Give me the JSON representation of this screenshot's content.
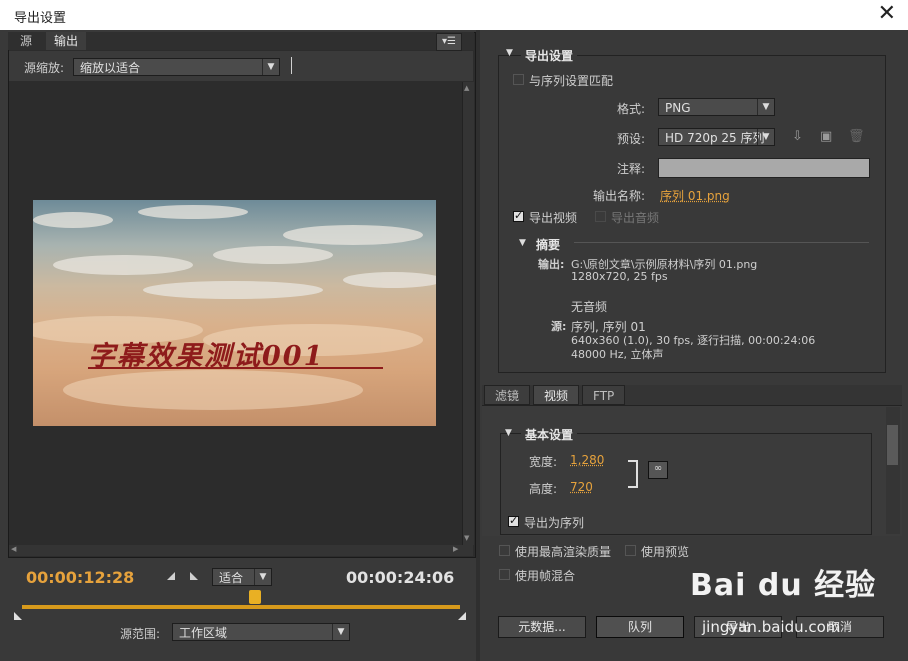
{
  "window": {
    "title": "导出设置",
    "close_glyph": "✕"
  },
  "left": {
    "tabs": [
      {
        "label": "源"
      },
      {
        "label": "输出"
      }
    ],
    "menu_icon": "▾☰",
    "source_scale_label": "源缩放:",
    "source_scale_value": "缩放以适合",
    "video_caption": "字幕效果测试001",
    "current_time": "00:00:12:28",
    "total_time": "00:00:24:06",
    "zoom_value": "适合",
    "source_range_label": "源范围:",
    "source_range_value": "工作区域"
  },
  "export": {
    "section_title": "导出设置",
    "match_sequence": "与序列设置匹配",
    "format_label": "格式:",
    "format_value": "PNG",
    "preset_label": "预设:",
    "preset_value": "HD 720p 25 序列",
    "comment_label": "注释:",
    "output_name_label": "输出名称:",
    "output_name_value": "序列 01.png",
    "export_video": "导出视频",
    "export_audio": "导出音频",
    "summary_title": "摘要",
    "output_label": "输出:",
    "output_line1": "G:\\原创文章\\示例原材料\\序列 01.png",
    "output_line2": "1280x720, 25 fps",
    "output_line3": "无音频",
    "source_label": "源:",
    "source_line1": "序列, 序列 01",
    "source_line2": "640x360 (1.0), 30 fps, 逐行扫描, 00:00:24:06",
    "source_line3": "48000 Hz, 立体声"
  },
  "tabs2": [
    {
      "label": "滤镜"
    },
    {
      "label": "视频"
    },
    {
      "label": "FTP"
    }
  ],
  "basic": {
    "title": "基本设置",
    "width_label": "宽度:",
    "width_value": "1,280",
    "height_label": "高度:",
    "height_value": "720",
    "export_as_sequence": "导出为序列"
  },
  "options": {
    "max_render": "使用最高渲染质量",
    "use_preview": "使用预览",
    "frame_blend": "使用帧混合"
  },
  "buttons": {
    "metadata": "元数据...",
    "queue": "队列",
    "export": "导出",
    "cancel": "取消"
  },
  "watermark": {
    "brand": "Bai du 经验",
    "url": "jingyan.baidu.com"
  },
  "colors": {
    "accent": "#e6a23c",
    "timeline": "#d79a1c",
    "caption": "#8e1b1b"
  }
}
